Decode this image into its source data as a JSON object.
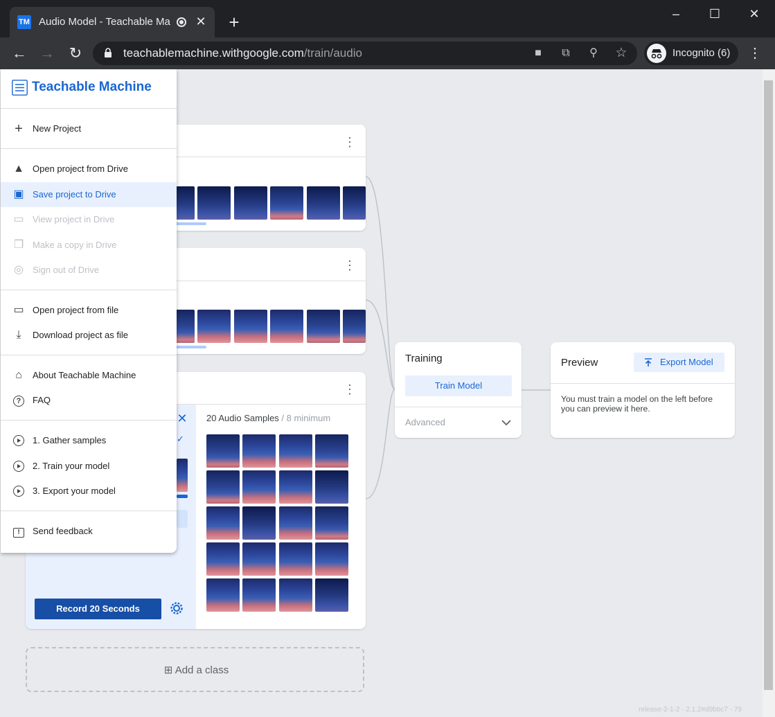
{
  "browser": {
    "tab_title": "Audio Model - Teachable Ma",
    "favicon": "TM",
    "url_host": "teachablemachine.withgoogle.com",
    "url_path": "/train/audio",
    "profile_label": "Incognito (6)",
    "window_controls": {
      "minimize": "–",
      "maximize": "☐",
      "close": "✕"
    }
  },
  "menu": {
    "title": "Teachable Machine",
    "groups": [
      [
        {
          "label": "New Project",
          "icon": "plus-icon",
          "glyph": "+"
        }
      ],
      [
        {
          "label": "Open project from Drive",
          "icon": "drive-icon",
          "glyph": "▲"
        },
        {
          "label": "Save project to Drive",
          "icon": "save-icon",
          "glyph": "▣",
          "active": true
        },
        {
          "label": "View project in Drive",
          "icon": "folder-icon",
          "glyph": "▭",
          "disabled": true
        },
        {
          "label": "Make a copy in Drive",
          "icon": "copy-icon",
          "glyph": "❐",
          "disabled": true
        },
        {
          "label": "Sign out of Drive",
          "icon": "account-icon",
          "glyph": "◎",
          "disabled": true
        }
      ],
      [
        {
          "label": "Open project from file",
          "icon": "folder-open-icon",
          "glyph": "▭"
        },
        {
          "label": "Download project as file",
          "icon": "download-icon",
          "glyph": "⤓"
        }
      ],
      [
        {
          "label": "About Teachable Machine",
          "icon": "home-icon",
          "glyph": "⌂"
        },
        {
          "label": "FAQ",
          "icon": "help-icon",
          "glyph": "?"
        }
      ],
      [
        {
          "label": "1. Gather samples",
          "icon": "play-circle-icon"
        },
        {
          "label": "2. Train your model",
          "icon": "play-circle-icon"
        },
        {
          "label": "3. Export your model",
          "icon": "play-circle-icon"
        }
      ],
      [
        {
          "label": "Send feedback",
          "icon": "feedback-icon",
          "glyph": "!"
        }
      ]
    ]
  },
  "class3": {
    "samples_count": "20 Audio Samples",
    "samples_min": " / 8 minimum",
    "record_button": "Record 20 Seconds"
  },
  "add_class": {
    "label": "Add a class",
    "glyph": "⊞"
  },
  "training": {
    "title": "Training",
    "train_button": "Train Model",
    "advanced": "Advanced"
  },
  "preview": {
    "title": "Preview",
    "export_button": "Export Model",
    "message": "You must train a model on the left before you can preview it here."
  },
  "footer": {
    "version": "release-2-1-2 - 2.1.2#d9bbc7 - 79"
  },
  "colors": {
    "accent": "#1967d2",
    "record_button_bg": "#174ea6",
    "menu_active_bg": "#e8f0fe"
  }
}
